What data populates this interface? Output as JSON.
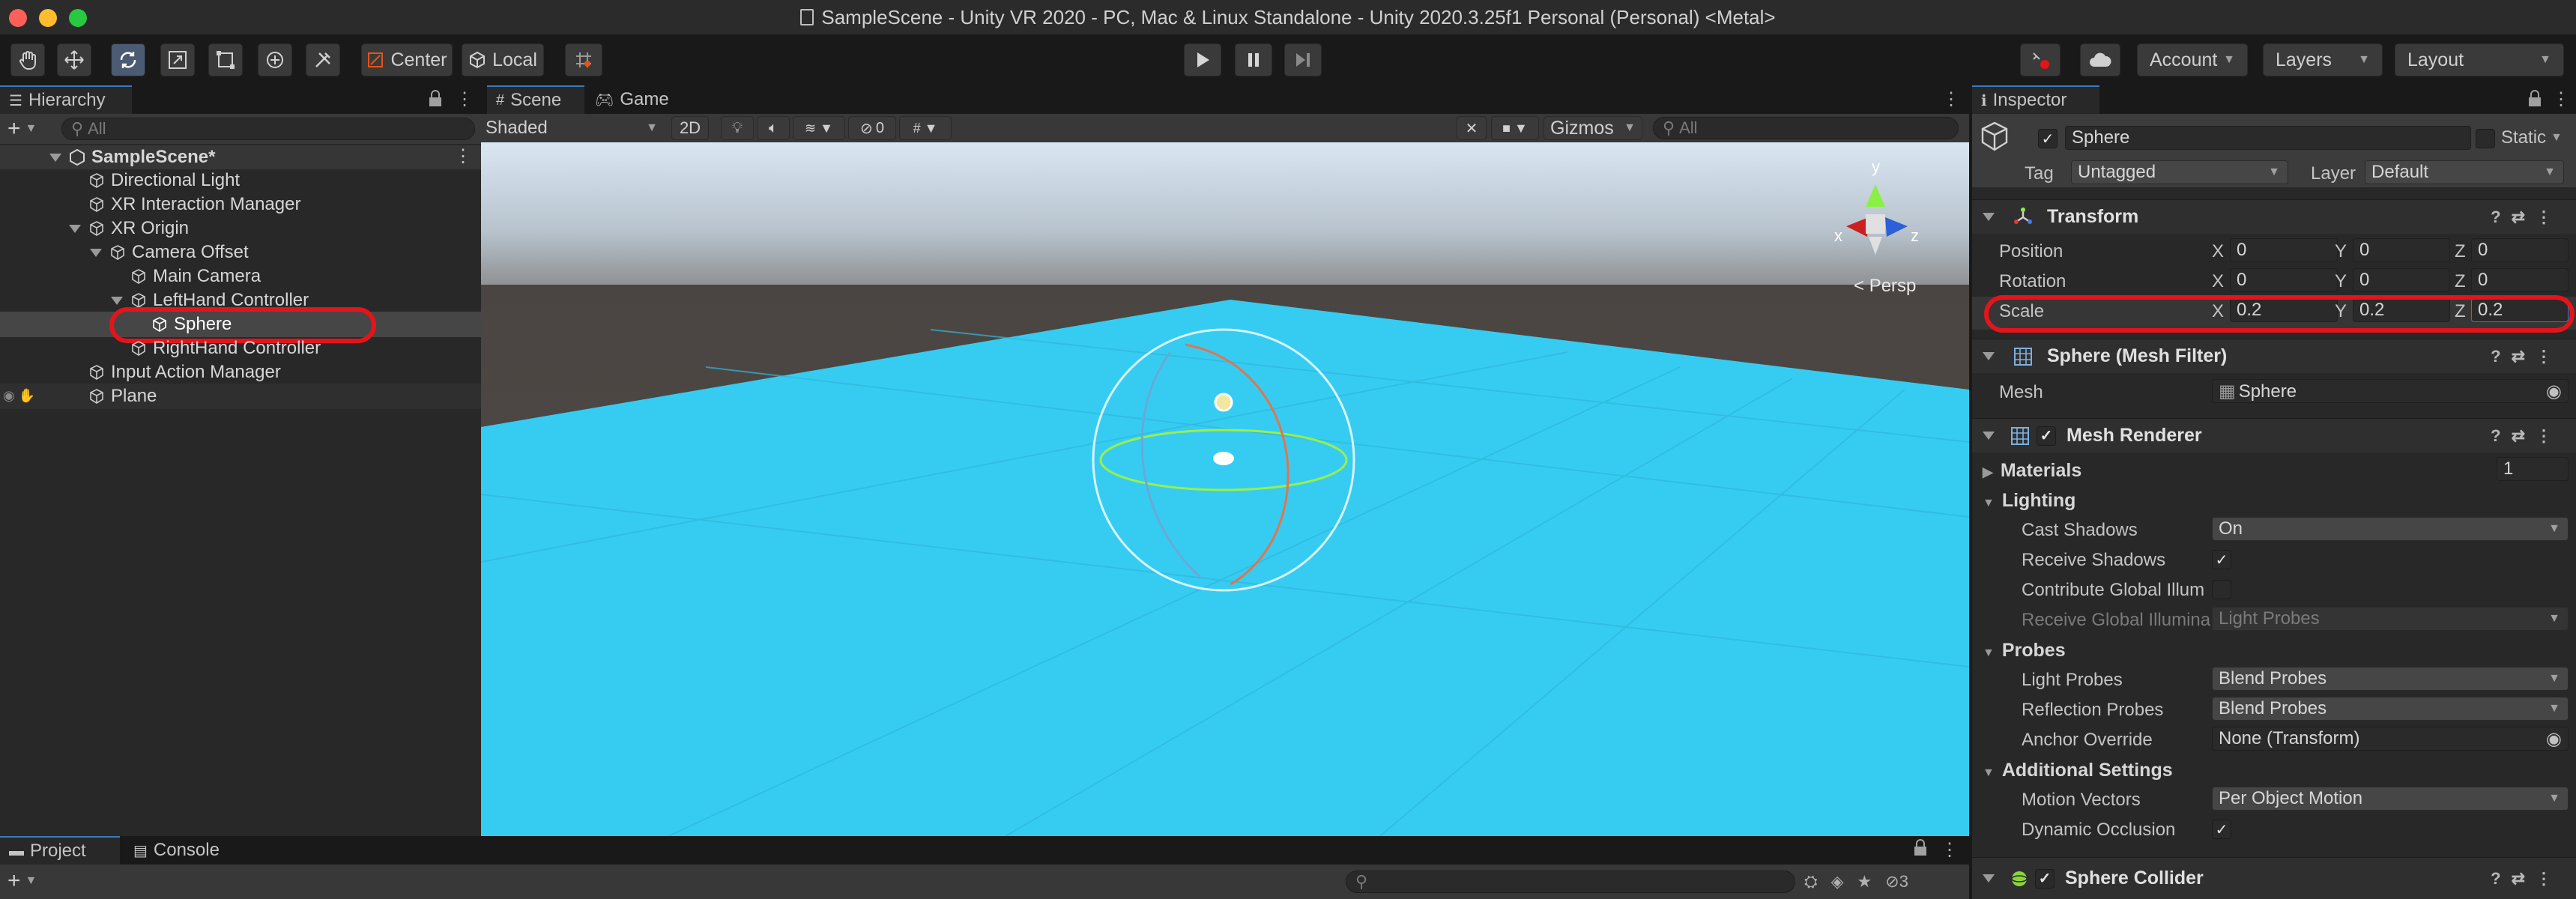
{
  "window": {
    "title": "SampleScene - Unity VR 2020 - PC, Mac & Linux Standalone - Unity 2020.3.25f1 Personal (Personal) <Metal>"
  },
  "toolbar": {
    "tools": [
      "hand-icon",
      "move-icon",
      "rotate-icon",
      "scale-icon",
      "rect-icon",
      "transform-icon",
      "custom-tool-icon"
    ],
    "pivot_label": "Center",
    "space_label": "Local",
    "account_label": "Account",
    "layers_label": "Layers",
    "layout_label": "Layout"
  },
  "hierarchy": {
    "tab_label": "Hierarchy",
    "search_placeholder": "All",
    "scene_name": "SampleScene*",
    "items": [
      "Directional Light",
      "XR Interaction Manager",
      "XR Origin",
      "Camera Offset",
      "Main Camera",
      "LeftHand Controller",
      "Sphere",
      "RightHand Controller",
      "Input Action Manager",
      "Plane"
    ]
  },
  "scene": {
    "tab_scene": "Scene",
    "tab_game": "Game",
    "shading": "Shaded",
    "mode_2d": "2D",
    "hidden_count": "0",
    "gizmos_label": "Gizmos",
    "search_placeholder": "All",
    "persp_label": "Persp",
    "axis_x": "x",
    "axis_y": "y",
    "axis_z": "z"
  },
  "bottom": {
    "tab_project": "Project",
    "tab_console": "Console",
    "hidden_count": "3"
  },
  "inspector": {
    "tab_label": "Inspector",
    "object_name": "Sphere",
    "static_label": "Static",
    "tag_label": "Tag",
    "tag_value": "Untagged",
    "layer_label": "Layer",
    "layer_value": "Default",
    "transform": {
      "title": "Transform",
      "position_label": "Position",
      "position": {
        "x": "0",
        "y": "0",
        "z": "0"
      },
      "rotation_label": "Rotation",
      "rotation": {
        "x": "0",
        "y": "0",
        "z": "0"
      },
      "scale_label": "Scale",
      "scale": {
        "x": "0.2",
        "y": "0.2",
        "z": "0.2"
      },
      "axis_x": "X",
      "axis_y": "Y",
      "axis_z": "Z"
    },
    "mesh_filter": {
      "title": "Sphere (Mesh Filter)",
      "mesh_label": "Mesh",
      "mesh_value": "Sphere"
    },
    "mesh_renderer": {
      "title": "Mesh Renderer",
      "materials_label": "Materials",
      "materials_count": "1",
      "lighting_label": "Lighting",
      "cast_shadows_label": "Cast Shadows",
      "cast_shadows_value": "On",
      "receive_shadows_label": "Receive Shadows",
      "contribute_gi_label": "Contribute Global Illum",
      "receive_gi_label": "Receive Global Illumina",
      "receive_gi_value": "Light Probes",
      "probes_label": "Probes",
      "light_probes_label": "Light Probes",
      "light_probes_value": "Blend Probes",
      "reflection_probes_label": "Reflection Probes",
      "reflection_probes_value": "Blend Probes",
      "anchor_override_label": "Anchor Override",
      "anchor_override_value": "None (Transform)",
      "additional_label": "Additional Settings",
      "motion_vectors_label": "Motion Vectors",
      "motion_vectors_value": "Per Object Motion",
      "dynamic_occlusion_label": "Dynamic Occlusion"
    },
    "sphere_collider": {
      "title": "Sphere Collider"
    }
  },
  "colors": {
    "highlight_red": "#e4141b",
    "sky": "#3fd0f5",
    "accent_blue": "#3a79bb"
  }
}
